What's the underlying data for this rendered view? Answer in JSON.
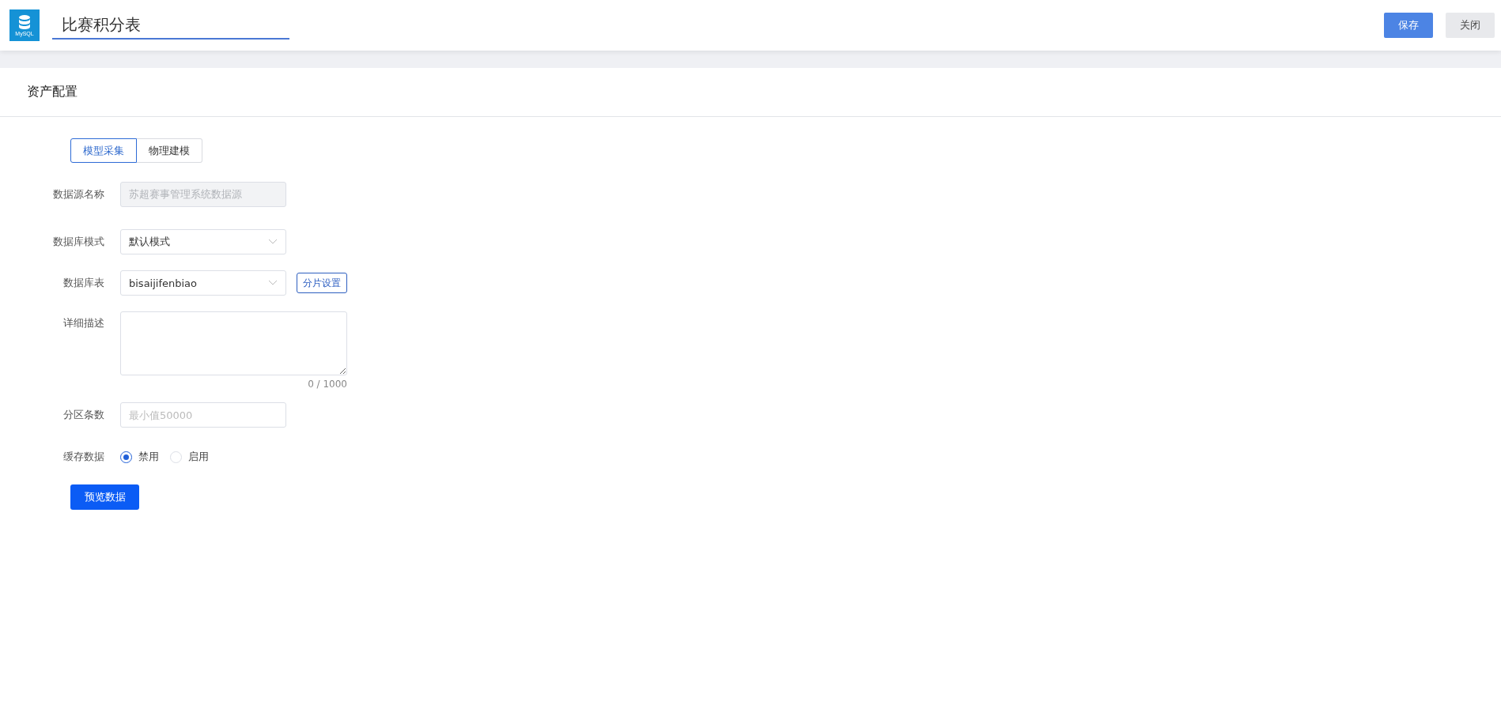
{
  "header": {
    "logo_text": "MySQL",
    "title": "比赛积分表",
    "buttons": [
      {
        "kind": "primary",
        "label": "保存"
      },
      {
        "kind": "default",
        "label": "关闭"
      }
    ]
  },
  "card": {
    "title": "资产配置",
    "tabs": [
      {
        "label": "模型采集",
        "selected": true
      },
      {
        "label": "物理建模",
        "selected": false
      }
    ],
    "fields": [
      {
        "kind": "input",
        "label": "数据源名称",
        "value": "苏超赛事管理系统数据源",
        "disabled": true
      },
      {
        "kind": "select",
        "label": "数据库模式",
        "value": "默认模式"
      },
      {
        "kind": "select",
        "label": "数据库表",
        "value": "bisaijifenbiao",
        "action": "分片设置"
      },
      {
        "kind": "textarea",
        "label": "详细描述",
        "counter": "0 / 1000"
      },
      {
        "kind": "input",
        "label": "分区条数",
        "placeholder": "最小值50000",
        "disabled": false
      },
      {
        "kind": "radio",
        "label": "缓存数据",
        "options": [
          {
            "label": "禁用",
            "selected": true
          },
          {
            "label": "启用",
            "selected": false
          }
        ]
      }
    ],
    "submit": "预览数据"
  }
}
